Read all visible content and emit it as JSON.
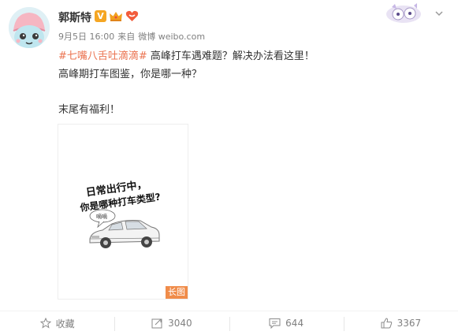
{
  "post": {
    "author": "郭斯特",
    "verified_badge": "V",
    "meta": {
      "date": "9月5日 16:00",
      "from_label": "来自",
      "source": "微博 weibo.com"
    },
    "topic": "#七嘴八舌吐滴滴#",
    "line1_rest": " 高峰打车遇难题？解决办法看这里！",
    "line2": "高峰期打车图鉴，你是哪一种？",
    "line3": "末尾有福利！",
    "image": {
      "headline1": "日常出行中，",
      "headline2": "你是哪种打车类型?",
      "bubble": "嘀嘀",
      "long_badge": "长图"
    }
  },
  "actions": {
    "favorite_label": "收藏",
    "repost_count": "3040",
    "comment_count": "644",
    "like_count": "3367"
  },
  "icons": {
    "crown": "crown-icon",
    "heart": "heart-badge-icon",
    "chevron": "chevron-down-icon",
    "star": "star-icon",
    "repost": "repost-icon",
    "comment": "comment-icon",
    "like": "thumbs-up-icon"
  },
  "colors": {
    "topic": "#eb7350",
    "badge": "#f5a623",
    "meta": "#808080"
  }
}
